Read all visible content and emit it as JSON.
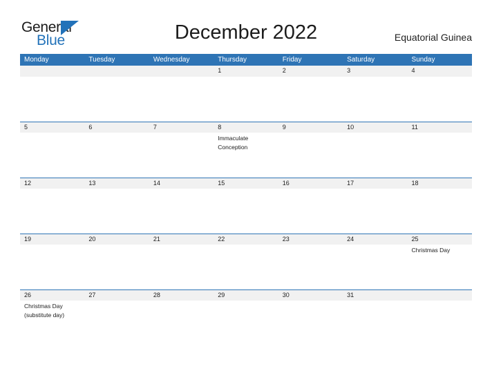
{
  "logo": {
    "word_one": "General",
    "word_two": "Blue",
    "flag_icon": "blue-triangle-flag",
    "color_dark": "#1a1a1a",
    "color_blue": "#2272b9"
  },
  "header": {
    "title": "December 2022",
    "country": "Equatorial Guinea"
  },
  "colors": {
    "header_blue": "#2e74b5",
    "date_band": "#f1f1f1",
    "text": "#1c1c1c",
    "weekday_text": "#ffffff"
  },
  "calendar": {
    "weekdays": [
      "Monday",
      "Tuesday",
      "Wednesday",
      "Thursday",
      "Friday",
      "Saturday",
      "Sunday"
    ],
    "weeks": [
      {
        "days": [
          {
            "num": "",
            "events": []
          },
          {
            "num": "",
            "events": []
          },
          {
            "num": "",
            "events": []
          },
          {
            "num": "1",
            "events": []
          },
          {
            "num": "2",
            "events": []
          },
          {
            "num": "3",
            "events": []
          },
          {
            "num": "4",
            "events": []
          }
        ]
      },
      {
        "days": [
          {
            "num": "5",
            "events": []
          },
          {
            "num": "6",
            "events": []
          },
          {
            "num": "7",
            "events": []
          },
          {
            "num": "8",
            "events": [
              "Immaculate",
              "Conception"
            ]
          },
          {
            "num": "9",
            "events": []
          },
          {
            "num": "10",
            "events": []
          },
          {
            "num": "11",
            "events": []
          }
        ]
      },
      {
        "days": [
          {
            "num": "12",
            "events": []
          },
          {
            "num": "13",
            "events": []
          },
          {
            "num": "14",
            "events": []
          },
          {
            "num": "15",
            "events": []
          },
          {
            "num": "16",
            "events": []
          },
          {
            "num": "17",
            "events": []
          },
          {
            "num": "18",
            "events": []
          }
        ]
      },
      {
        "days": [
          {
            "num": "19",
            "events": []
          },
          {
            "num": "20",
            "events": []
          },
          {
            "num": "21",
            "events": []
          },
          {
            "num": "22",
            "events": []
          },
          {
            "num": "23",
            "events": []
          },
          {
            "num": "24",
            "events": []
          },
          {
            "num": "25",
            "events": [
              "Christmas Day"
            ]
          }
        ]
      },
      {
        "days": [
          {
            "num": "26",
            "events": [
              "Christmas Day",
              "(substitute day)"
            ]
          },
          {
            "num": "27",
            "events": []
          },
          {
            "num": "28",
            "events": []
          },
          {
            "num": "29",
            "events": []
          },
          {
            "num": "30",
            "events": []
          },
          {
            "num": "31",
            "events": []
          },
          {
            "num": "",
            "events": []
          }
        ]
      }
    ]
  }
}
